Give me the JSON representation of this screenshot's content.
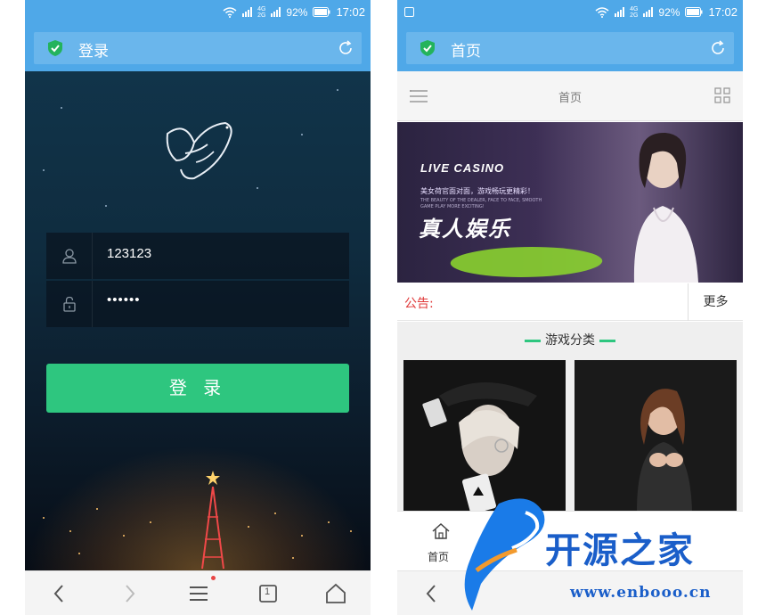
{
  "status_bar": {
    "battery": "92%",
    "time": "17:02",
    "net_label_top": "4G",
    "net_label_bottom": "2G"
  },
  "login_screen": {
    "page_title": "登录",
    "username_value": "123123",
    "password_value": "••••••",
    "login_button": "登 录"
  },
  "home_screen": {
    "page_title": "首页",
    "nav_title": "首页",
    "banner": {
      "title": "LIVE CASINO",
      "subtitle": "美女荷官面对面，游戏畅玩更精彩！",
      "subtitle_en": "THE BEAUTY OF THE DEALER, FACE TO FACE, SMOOTH GAME PLAY MORE EXCITING!",
      "big_text": "真人娱乐"
    },
    "notice_label": "公告:",
    "more_label": "更多",
    "section_title": "游戏分类",
    "tab_home_label": "首页"
  },
  "browser_nav": {
    "tab_count": "1"
  },
  "watermark": {
    "brand": "开源之家",
    "url": "www.enbooo.cn"
  },
  "colors": {
    "status_blue": "#4fa8e8",
    "login_green": "#2ec67f",
    "notice_red": "#e03a3a",
    "watermark_blue": "#1a5ec9"
  }
}
